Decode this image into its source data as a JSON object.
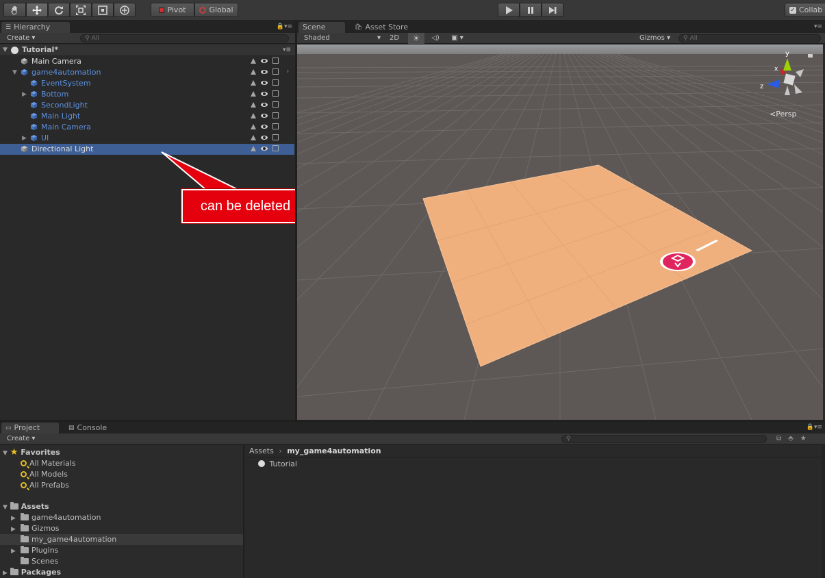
{
  "toolbar": {
    "tools": [
      {
        "name": "hand-tool"
      },
      {
        "name": "move-tool"
      },
      {
        "name": "rotate-tool"
      },
      {
        "name": "scale-tool"
      },
      {
        "name": "rect-tool"
      },
      {
        "name": "transform-tool"
      }
    ],
    "pivot_label": "Pivot",
    "global_label": "Global",
    "collab_label": "Collab"
  },
  "hierarchy": {
    "tab_label": "Hierarchy",
    "create_label": "Create",
    "search_placeholder": "All",
    "scene_name": "Tutorial*",
    "items": [
      {
        "label": "Main Camera",
        "color": "white",
        "indent": 0,
        "expand": "none"
      },
      {
        "label": "game4automation",
        "color": "blue",
        "indent": 0,
        "expand": "open"
      },
      {
        "label": "EventSystem",
        "color": "blue",
        "indent": 1,
        "expand": "none"
      },
      {
        "label": "Bottom",
        "color": "blue",
        "indent": 1,
        "expand": "closed"
      },
      {
        "label": "SecondLight",
        "color": "blue",
        "indent": 1,
        "expand": "none"
      },
      {
        "label": "Main Light",
        "color": "blue",
        "indent": 1,
        "expand": "none"
      },
      {
        "label": "Main Camera",
        "color": "blue",
        "indent": 1,
        "expand": "none"
      },
      {
        "label": "UI",
        "color": "blue",
        "indent": 1,
        "expand": "closed"
      },
      {
        "label": "Directional Light",
        "color": "white",
        "indent": 0,
        "expand": "none",
        "selected": true
      }
    ]
  },
  "callout": {
    "text": "can be deleted"
  },
  "scene": {
    "tabs": [
      "Scene",
      "Asset Store"
    ],
    "shading_mode": "Shaded",
    "mode_2d_label": "2D",
    "gizmos_label": "Gizmos",
    "search_placeholder": "All",
    "persp_label": "Persp",
    "axis_labels": {
      "x": "x",
      "y": "y",
      "z": "z"
    },
    "colors": {
      "floor": "#f0b07e",
      "ground": "#5d5855",
      "sky": "#8b8e93",
      "logo": "#e0245e"
    }
  },
  "project": {
    "tabs": [
      "Project",
      "Console"
    ],
    "create_label": "Create",
    "favorites": {
      "label": "Favorites",
      "items": [
        "All Materials",
        "All Models",
        "All Prefabs"
      ]
    },
    "assets": {
      "label": "Assets",
      "items": [
        {
          "label": "game4automation",
          "expand": true
        },
        {
          "label": "Gizmos",
          "expand": true
        },
        {
          "label": "my_game4automation",
          "expand": false,
          "selected": true
        },
        {
          "label": "Plugins",
          "expand": true
        },
        {
          "label": "Scenes",
          "expand": false
        }
      ]
    },
    "packages_label": "Packages",
    "breadcrumb": [
      "Assets",
      "my_game4automation"
    ],
    "files": [
      "Tutorial"
    ]
  }
}
